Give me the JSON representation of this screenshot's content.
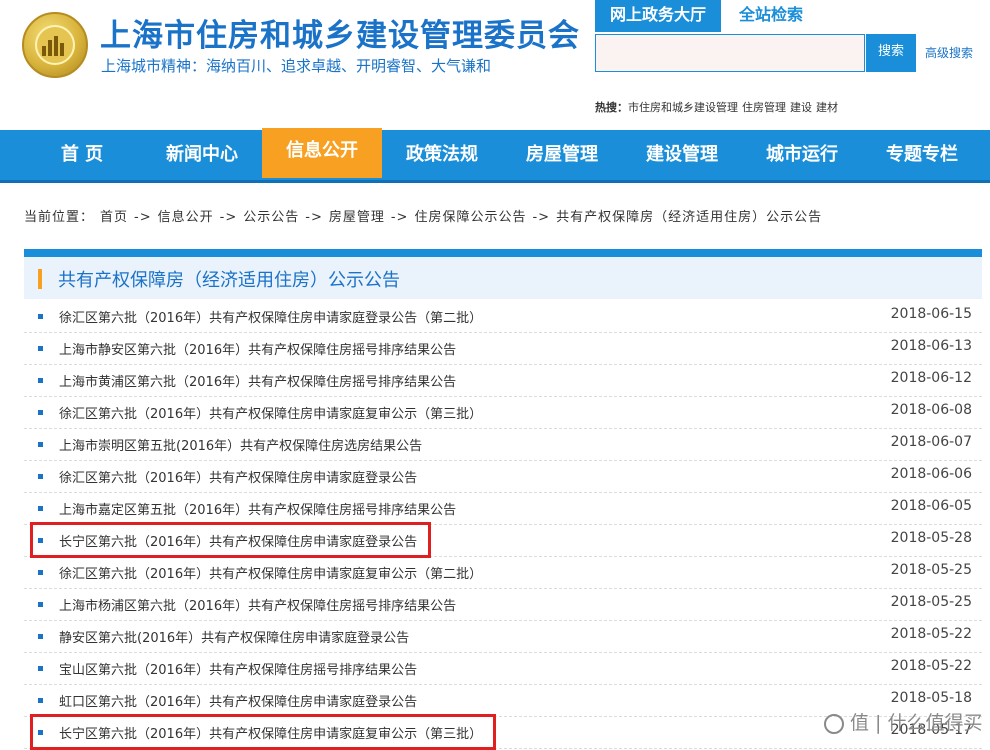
{
  "header": {
    "site_title": "上海市住房和城乡建设管理委员会",
    "slogan": "上海城市精神：海纳百川、追求卓越、开明睿智、大气谦和",
    "egov_tab": "网上政务大厅",
    "search_tab": "全站检索",
    "search": {
      "placeholder": "",
      "button": "搜索",
      "advanced": "高级搜索"
    },
    "hot": {
      "label": "热搜：",
      "terms": [
        "市住房和城乡建设管理",
        "住房管理",
        "建设",
        "建材"
      ]
    }
  },
  "nav": [
    "首 页",
    "新闻中心",
    "信息公开",
    "政策法规",
    "房屋管理",
    "建设管理",
    "城市运行",
    "专题专栏"
  ],
  "nav_active": "信息公开",
  "breadcrumb": {
    "prefix": "当前位置：",
    "items": [
      "首页",
      "信息公开",
      "公示公告",
      "房屋管理",
      "住房保障公示公告",
      "共有产权保障房（经济适用住房）公示公告"
    ],
    "separator": "->"
  },
  "panel": {
    "title": "共有产权保障房（经济适用住房）公示公告",
    "rows": [
      {
        "title": "徐汇区第六批（2016年）共有产权保障住房申请家庭登录公告（第二批）",
        "date": "2018-06-15",
        "highlighted": false
      },
      {
        "title": "上海市静安区第六批（2016年）共有产权保障住房摇号排序结果公告",
        "date": "2018-06-13",
        "highlighted": false
      },
      {
        "title": "上海市黄浦区第六批（2016年）共有产权保障住房摇号排序结果公告",
        "date": "2018-06-12",
        "highlighted": false
      },
      {
        "title": "徐汇区第六批（2016年）共有产权保障住房申请家庭复审公示（第三批）",
        "date": "2018-06-08",
        "highlighted": false
      },
      {
        "title": "上海市崇明区第五批(2016年）共有产权保障住房选房结果公告",
        "date": "2018-06-07",
        "highlighted": false
      },
      {
        "title": "徐汇区第六批（2016年）共有产权保障住房申请家庭登录公告",
        "date": "2018-06-06",
        "highlighted": false
      },
      {
        "title": "上海市嘉定区第五批（2016年）共有产权保障住房摇号排序结果公告",
        "date": "2018-06-05",
        "highlighted": false
      },
      {
        "title": "长宁区第六批（2016年）共有产权保障住房申请家庭登录公告",
        "date": "2018-05-28",
        "highlighted": true
      },
      {
        "title": "徐汇区第六批（2016年）共有产权保障住房申请家庭复审公示（第二批）",
        "date": "2018-05-25",
        "highlighted": false
      },
      {
        "title": "上海市杨浦区第六批（2016年）共有产权保障住房摇号排序结果公告",
        "date": "2018-05-25",
        "highlighted": false
      },
      {
        "title": "静安区第六批(2016年）共有产权保障住房申请家庭登录公告",
        "date": "2018-05-22",
        "highlighted": false
      },
      {
        "title": "宝山区第六批（2016年）共有产权保障住房摇号排序结果公告",
        "date": "2018-05-22",
        "highlighted": false
      },
      {
        "title": "虹口区第六批（2016年）共有产权保障住房申请家庭登录公告",
        "date": "2018-05-18",
        "highlighted": false
      },
      {
        "title": "长宁区第六批（2016年）共有产权保障住房申请家庭复审公示（第三批）",
        "date": "2018-05-17",
        "highlighted": true
      }
    ]
  },
  "watermark": {
    "text": "值 | 什么值得买",
    "icon": "smzdm-logo-icon"
  },
  "colors": {
    "primary": "#1a8ed8",
    "accent": "#f7a021",
    "highlight": "#e02020",
    "link": "#1a73c8"
  }
}
